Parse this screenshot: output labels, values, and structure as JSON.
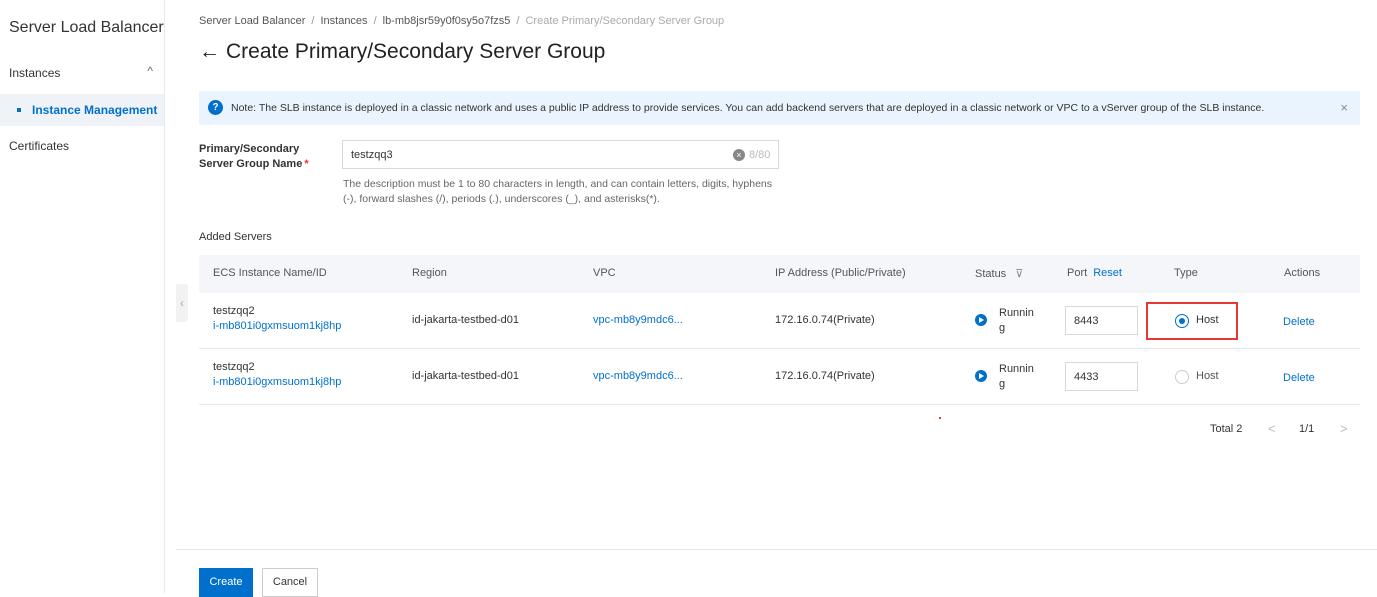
{
  "sidebar": {
    "title": "Server Load Balancer",
    "group_label": "Instances",
    "group_chevron": "^",
    "active_item": "Instance Management",
    "item_certificates": "Certificates"
  },
  "breadcrumb": [
    "Server Load Balancer",
    "Instances",
    "lb-mb8jsr59y0f0sy5o7fzs5",
    "Create Primary/Secondary Server Group"
  ],
  "breadcrumb_sep": "/",
  "page": {
    "back_arrow": "←",
    "title": "Create Primary/Secondary Server Group"
  },
  "notice": {
    "icon": "?",
    "text": "Note: The SLB instance is deployed in a classic network and uses a public IP address to provide services. You can add backend servers that are deployed in a classic network or VPC to a vServer group of the SLB instance.",
    "close": "×"
  },
  "form": {
    "group_name_label": "Primary/Secondary Server Group Name",
    "required_mark": "*",
    "group_name_value": "testzqq3",
    "clear_icon": "×",
    "char_count": "8/80",
    "help_text": "The description must be 1 to 80 characters in length, and can contain letters, digits, hyphens (-), forward slashes (/), periods (.), underscores (_), and asterisks(*)."
  },
  "added_servers_label": "Added Servers",
  "table": {
    "headers": {
      "name": "ECS Instance Name/ID",
      "region": "Region",
      "vpc": "VPC",
      "ip": "IP Address (Public/Private)",
      "status": "Status",
      "status_filter_icon": "⊽",
      "port": "Port",
      "port_reset": "Reset",
      "type": "Type",
      "actions": "Actions"
    },
    "rows": [
      {
        "name": "testzqq2",
        "id": "i-mb801i0gxmsuom1kj8hp",
        "region": "id-jakarta-testbed-d01",
        "vpc": "vpc-mb8y9mdc6...",
        "ip": "172.16.0.74(Private)",
        "status": "Running",
        "port": "8443",
        "type": "Host",
        "type_selected": true,
        "action": "Delete"
      },
      {
        "name": "testzqq2",
        "id": "i-mb801i0gxmsuom1kj8hp",
        "region": "id-jakarta-testbed-d01",
        "vpc": "vpc-mb8y9mdc6...",
        "ip": "172.16.0.74(Private)",
        "status": "Running",
        "port": "4433",
        "type": "Host",
        "type_selected": false,
        "action": "Delete"
      }
    ]
  },
  "pagination": {
    "total": "Total 2",
    "prev": "<",
    "page": "1/1",
    "next": ">"
  },
  "buttons": {
    "create": "Create",
    "cancel": "Cancel"
  },
  "colors": {
    "accent": "#0070cc",
    "highlight": "#e53935",
    "notice_bg": "#eaf4fe"
  }
}
